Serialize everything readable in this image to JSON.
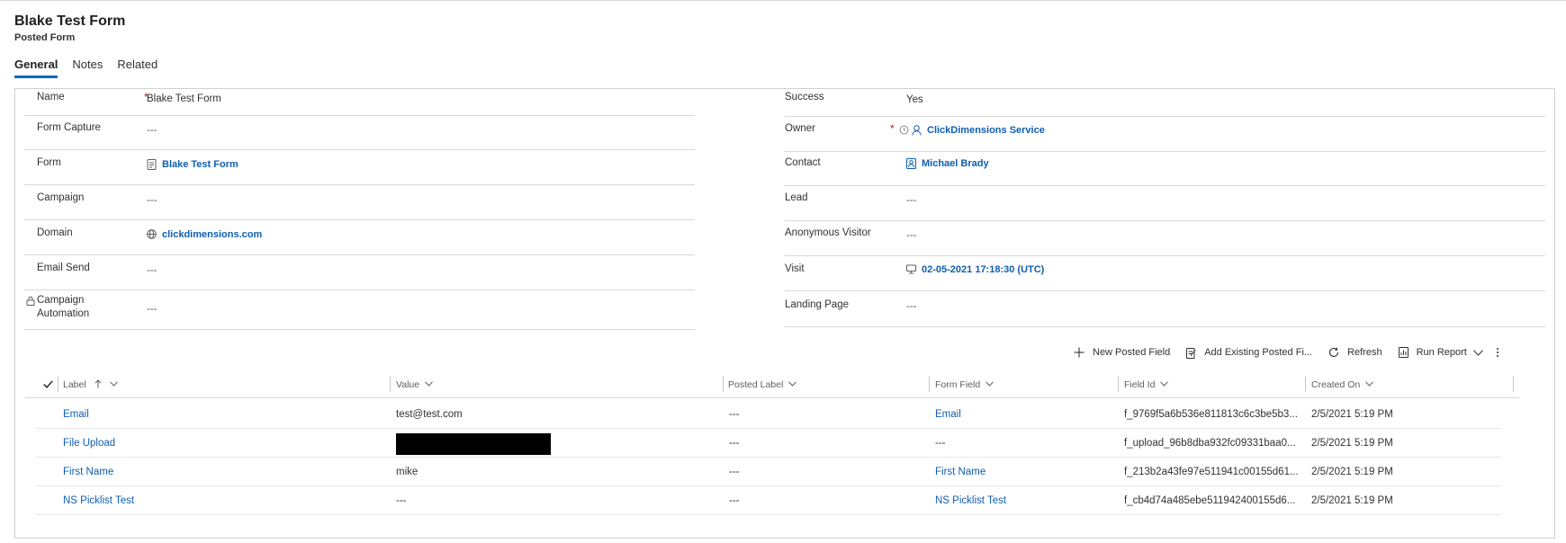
{
  "header": {
    "title": "Blake Test Form",
    "subtitle": "Posted Form"
  },
  "tabs": [
    {
      "label": "General"
    },
    {
      "label": "Notes"
    },
    {
      "label": "Related"
    }
  ],
  "left_fields": [
    {
      "label": "Name",
      "required": "*",
      "value": "Blake Test Form"
    },
    {
      "label": "Form Capture",
      "value": "---"
    },
    {
      "label": "Form",
      "value": "Blake Test Form",
      "icon": "form-icon"
    },
    {
      "label": "Campaign",
      "value": "---"
    },
    {
      "label": "Domain",
      "value": "clickdimensions.com",
      "icon": "globe-icon"
    },
    {
      "label": "Email Send",
      "value": "---"
    },
    {
      "label": "Campaign Automation",
      "value": "---",
      "icon": "lock-icon"
    }
  ],
  "right_fields": [
    {
      "label": "Success",
      "value": "Yes"
    },
    {
      "label": "Owner",
      "required": "*",
      "value": "ClickDimensions Service",
      "icon": "person-icon"
    },
    {
      "label": "Contact",
      "value": "Michael Brady",
      "icon": "contact-card-icon"
    },
    {
      "label": "Lead",
      "value": "---"
    },
    {
      "label": "Anonymous Visitor",
      "value": "---"
    },
    {
      "label": "Visit",
      "value": "02-05-2021 17:18:30 (UTC)",
      "icon": "monitor-icon"
    },
    {
      "label": "Landing Page",
      "value": "---"
    }
  ],
  "subgrid": {
    "commands": [
      {
        "label": "New Posted Field",
        "icon": "plus-icon"
      },
      {
        "label": "Add Existing Posted Fi...",
        "icon": "add-existing-icon"
      },
      {
        "label": "Refresh",
        "icon": "refresh-icon"
      },
      {
        "label": "Run Report",
        "icon": "report-icon"
      }
    ],
    "columns": [
      "Label",
      "Value",
      "Posted Label",
      "Form Field",
      "Field Id",
      "Created On"
    ],
    "rows": [
      {
        "label": "Email",
        "value": "test@test.com",
        "posted_label": "---",
        "form_field": "Email",
        "field_id": "f_9769f5a6b536e811813c6c3be5b3...",
        "created_on": "2/5/2021 5:19 PM"
      },
      {
        "label": "File Upload",
        "value": "",
        "posted_label": "---",
        "form_field": "---",
        "field_id": "f_upload_96b8dba932fc09331baa0...",
        "created_on": "2/5/2021 5:19 PM"
      },
      {
        "label": "First Name",
        "value": "mike",
        "posted_label": "---",
        "form_field": "First Name",
        "field_id": "f_213b2a43fe97e511941c00155d61...",
        "created_on": "2/5/2021 5:19 PM"
      },
      {
        "label": "NS Picklist Test",
        "value": "---",
        "posted_label": "---",
        "form_field": "NS Picklist Test",
        "field_id": "f_cb4d74a485ebe511942400155d6...",
        "created_on": "2/5/2021 5:19 PM"
      }
    ]
  },
  "colors": {
    "accent": "#0f6cbd",
    "link": "#0f5eb1",
    "required": "#a4262c",
    "border": "#d8d8d8"
  }
}
